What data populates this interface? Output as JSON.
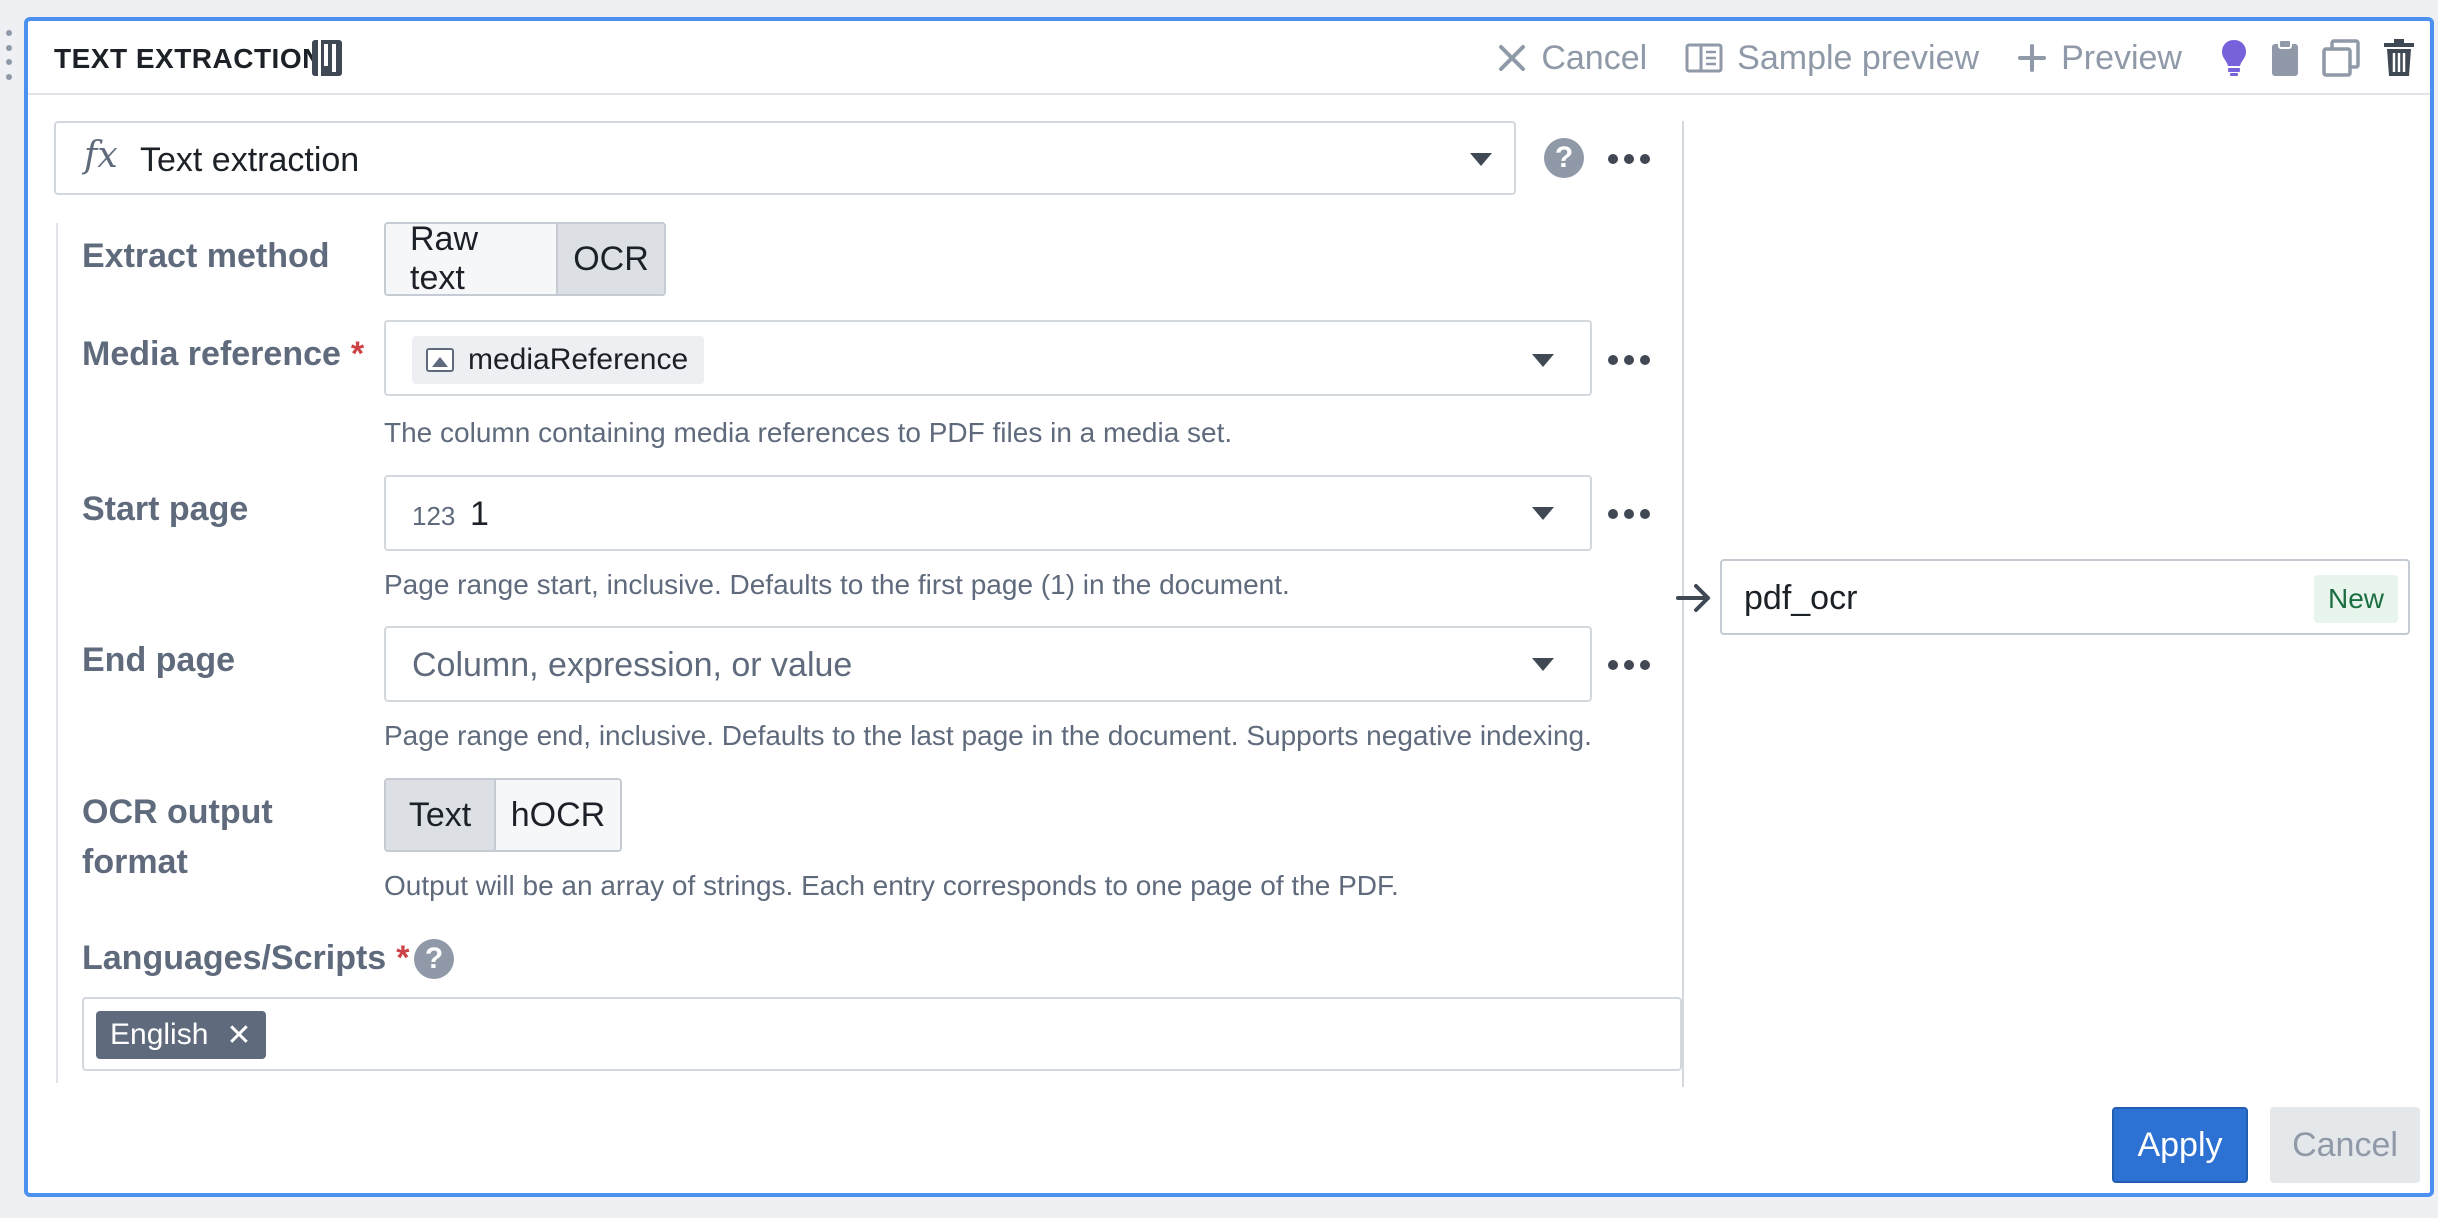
{
  "header": {
    "title": "TEXT EXTRACTION",
    "toolbar": {
      "cancel_label": "Cancel",
      "sample_preview_label": "Sample preview",
      "preview_label": "Preview"
    }
  },
  "function_select": {
    "icon": "fx",
    "value": "Text extraction"
  },
  "form": {
    "extract_method": {
      "label": "Extract method",
      "options": [
        "Raw text",
        "OCR"
      ],
      "selected": "OCR"
    },
    "media_reference": {
      "label": "Media reference",
      "required_mark": "*",
      "value": "mediaReference",
      "hint": "The column containing media references to PDF files in a media set."
    },
    "start_page": {
      "label": "Start page",
      "type_tag": "123",
      "value": "1",
      "hint": "Page range start, inclusive. Defaults to the first page (1) in the document."
    },
    "end_page": {
      "label": "End page",
      "placeholder": "Column, expression, or value",
      "hint": "Page range end, inclusive. Defaults to the last page in the document. Supports negative indexing."
    },
    "ocr_output_format": {
      "label_line1": "OCR output",
      "label_line2": "format",
      "options": [
        "Text",
        "hOCR"
      ],
      "selected": "Text",
      "hint": "Output will be an array of strings. Each entry corresponds to one page of the PDF."
    },
    "languages": {
      "label": "Languages/Scripts",
      "required_mark": "*",
      "tags": [
        "English"
      ]
    }
  },
  "output": {
    "name": "pdf_ocr",
    "badge": "New"
  },
  "footer": {
    "apply_label": "Apply",
    "cancel_label": "Cancel"
  },
  "colors": {
    "accent": "#2d72d2",
    "card_border": "#4c90f0",
    "hint_bulb": "#7961db",
    "required": "#cd4246"
  }
}
